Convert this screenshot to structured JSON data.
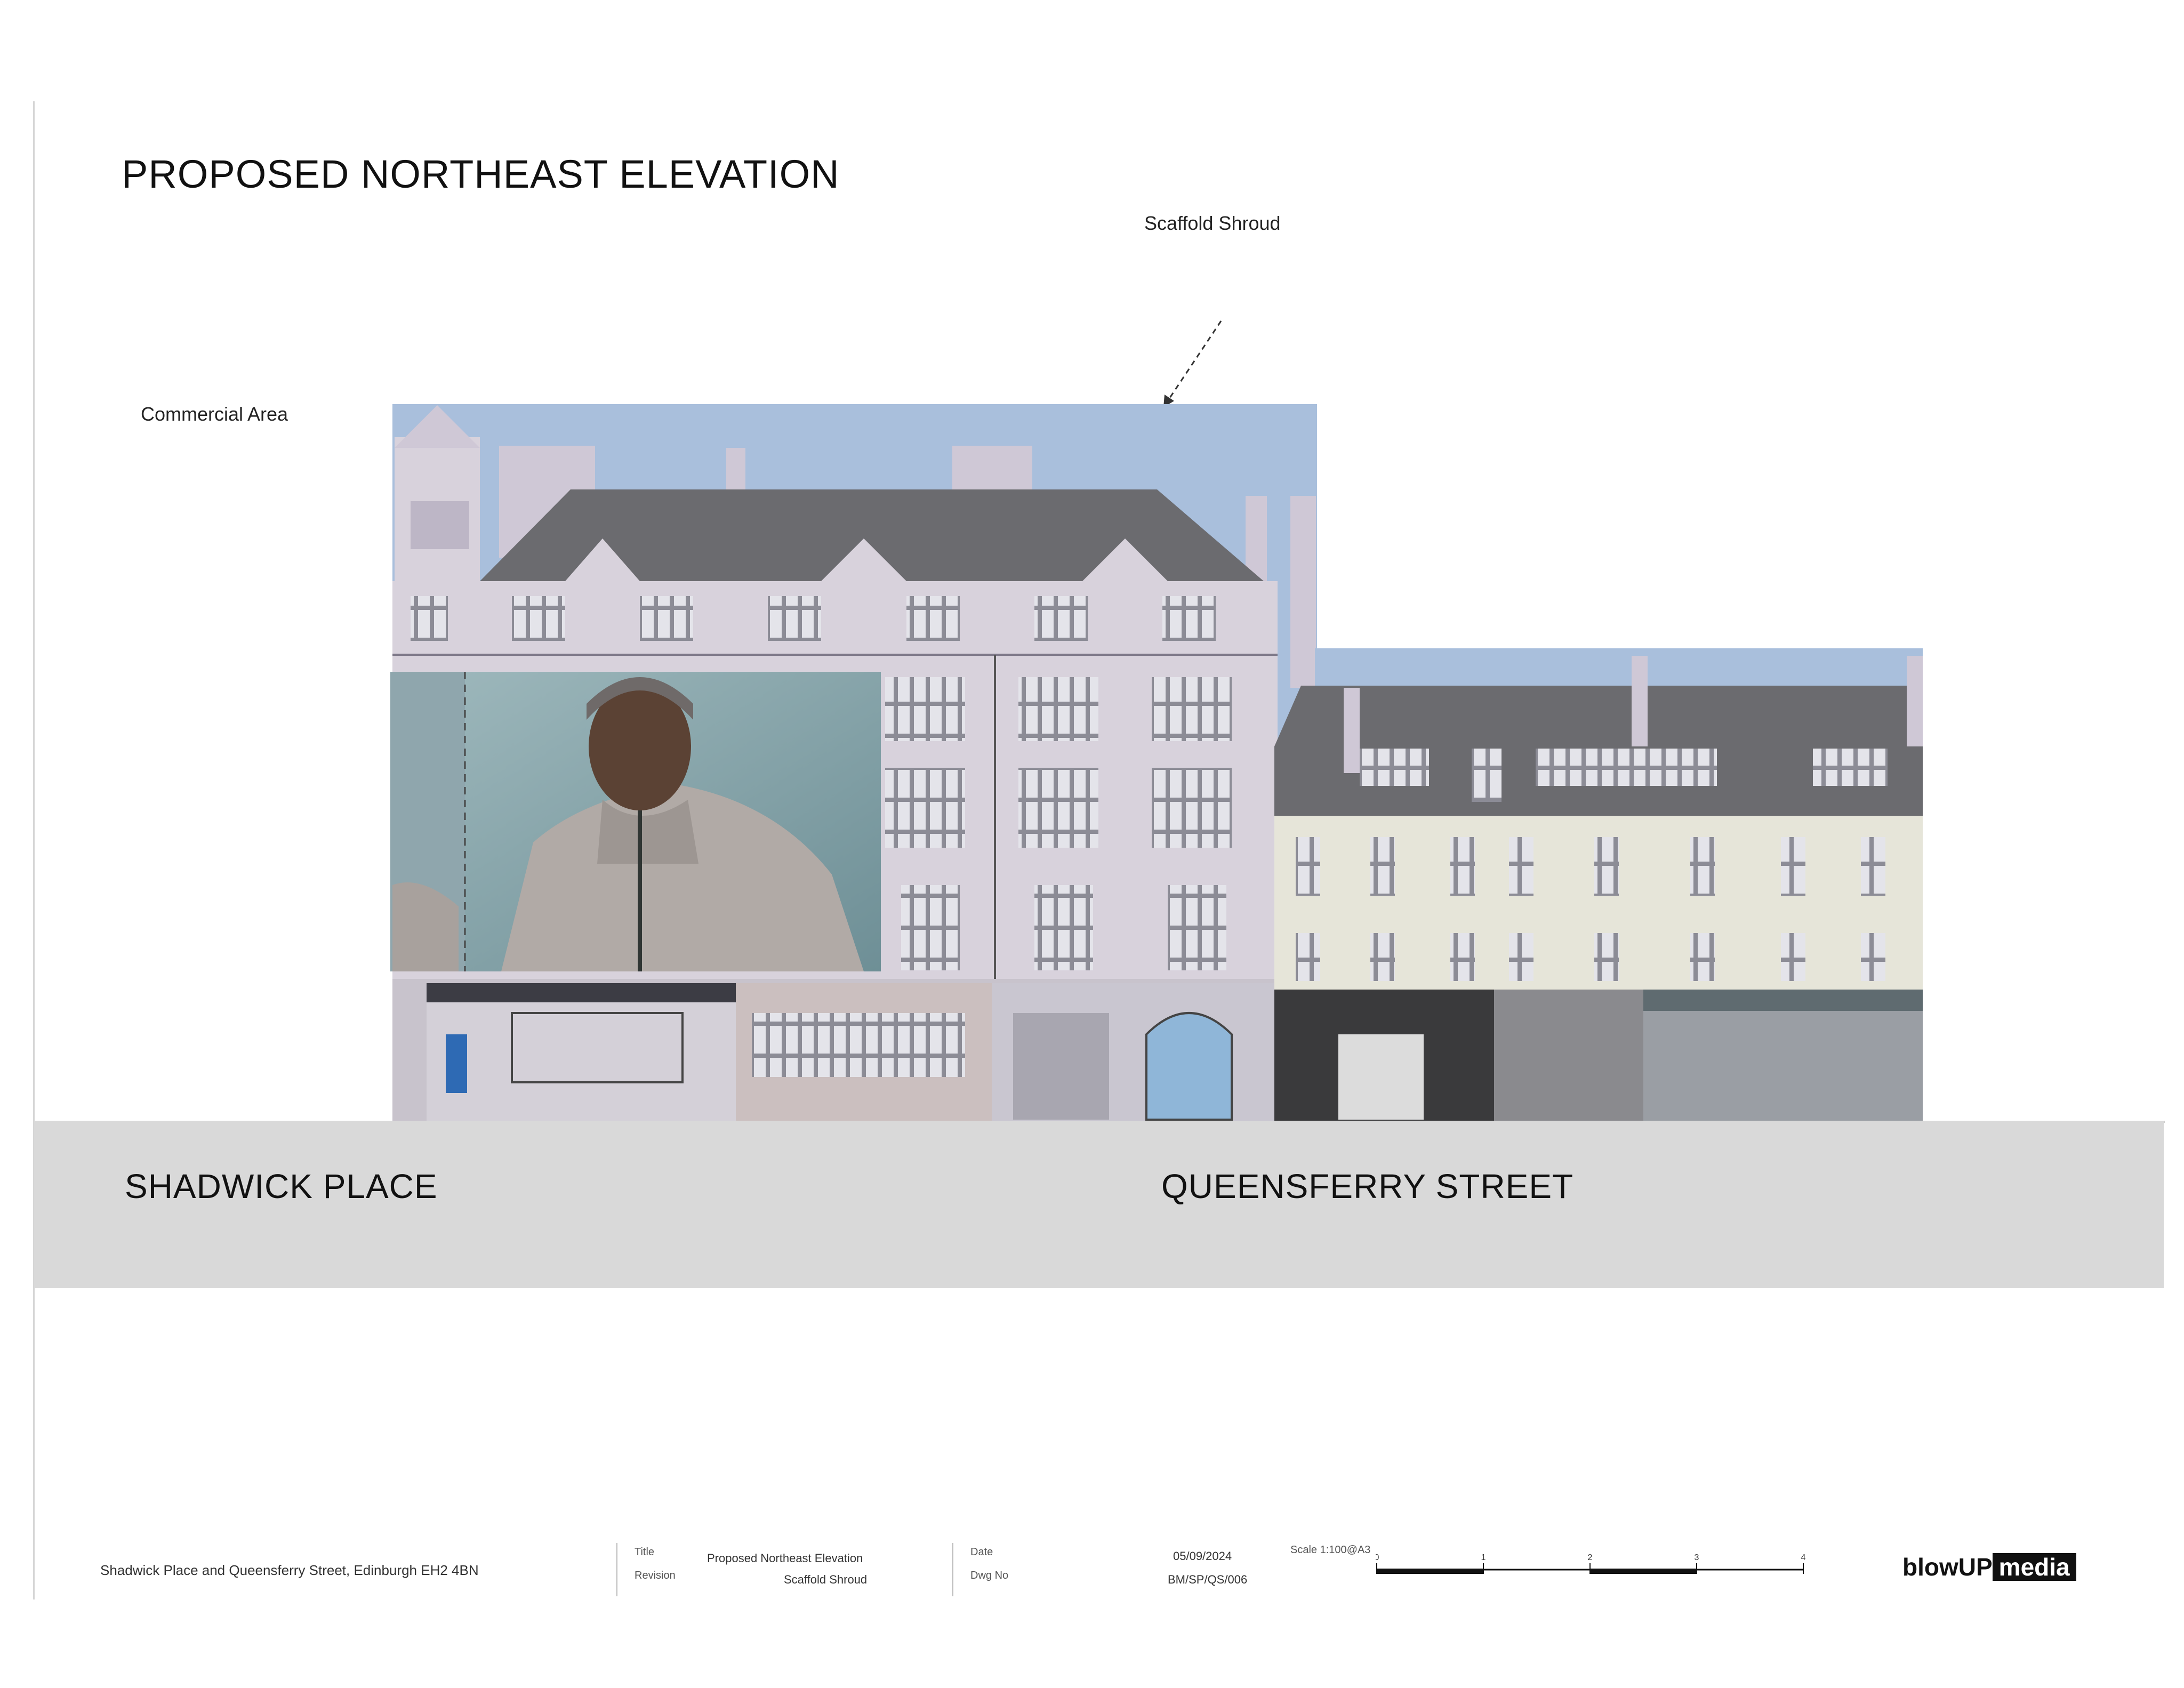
{
  "drawing": {
    "title": "PROPOSED  NORTHEAST ELEVATION",
    "annotations": {
      "scaffold_shroud": "Scaffold Shroud",
      "commercial_area": "Commercial Area"
    },
    "streets": {
      "left": "SHADWICK PLACE",
      "right": "QUEENSFERRY STREET"
    }
  },
  "title_block": {
    "project": "Shadwick Place and Queensferry Street, Edinburgh EH2 4BN",
    "title_label": "Title",
    "title_value": "Proposed Northeast Elevation",
    "revision_label": "Revision",
    "revision_value": "Scaffold Shroud",
    "date_label": "Date",
    "date_value": "05/09/2024",
    "drawing_no_label": "Dwg No",
    "drawing_no_value": "BM/SP/QS/006",
    "scale_label": "Scale 1:100@A3",
    "scale_ticks": [
      "0",
      "1",
      "2",
      "3",
      "4"
    ],
    "logo_text": "blowUP",
    "logo_highlight": "media"
  },
  "colors": {
    "sky": "#a9bfdc",
    "roof": "#6b6b6f",
    "facade_left": "#d8d2dc",
    "facade_right": "#e6e5d9",
    "shopfront_dark": "#3a3a3c",
    "street_band": "#d9d9d9",
    "billboard_bg": "#8fa9ae"
  }
}
